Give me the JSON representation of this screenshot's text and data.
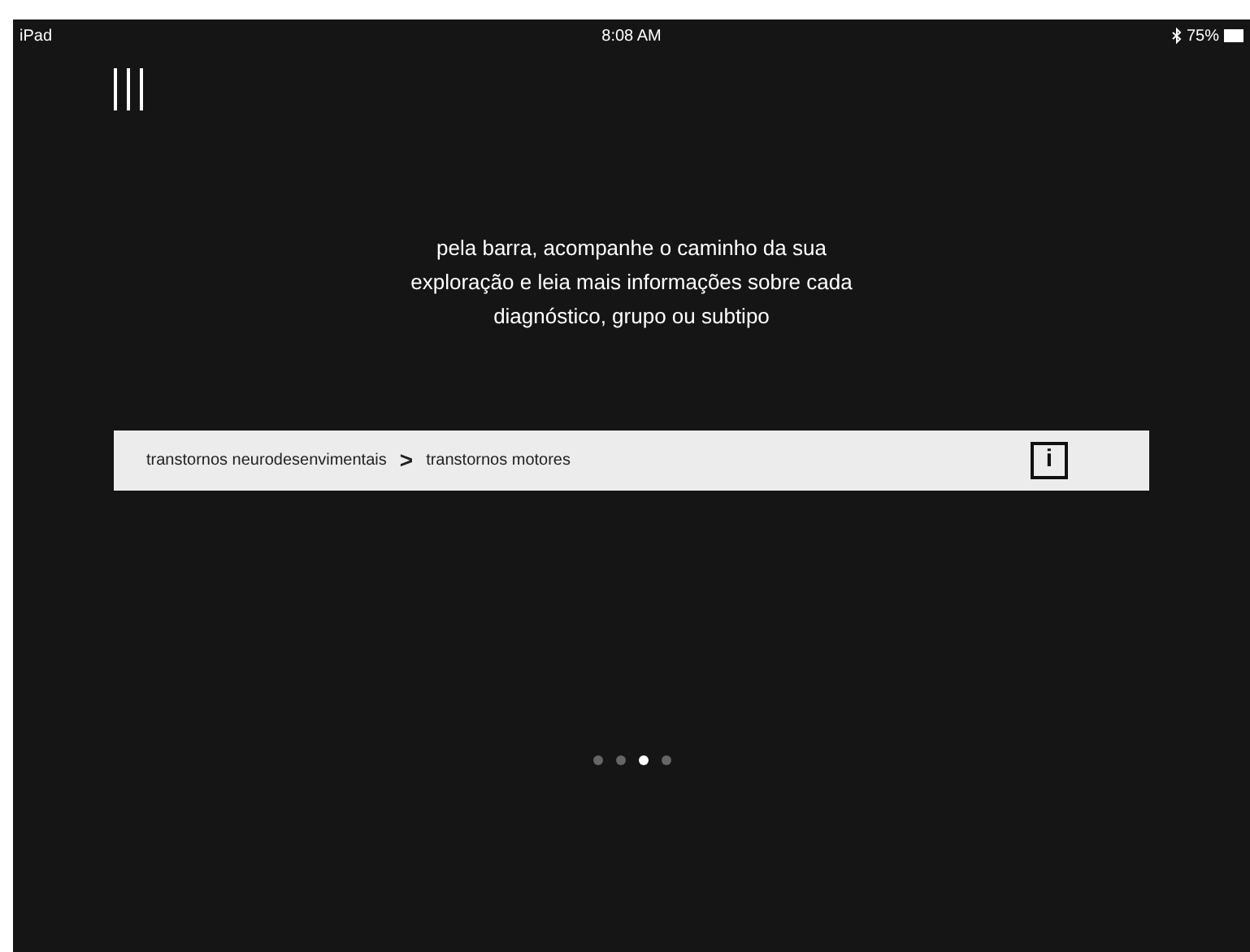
{
  "status_bar": {
    "device": "iPad",
    "time": "8:08 AM",
    "battery": "75%"
  },
  "hint": "pela barra, acompanhe o caminho da sua exploração e leia mais informações sobre cada diagnóstico, grupo ou subtipo",
  "breadcrumb": {
    "items": [
      "transtornos neurodesenvimentais",
      "transtornos motores"
    ],
    "separator": ">",
    "info": "i"
  },
  "pages": [
    {
      "selected": false
    },
    {
      "selected": false
    },
    {
      "selected": true
    },
    {
      "selected": false
    }
  ]
}
